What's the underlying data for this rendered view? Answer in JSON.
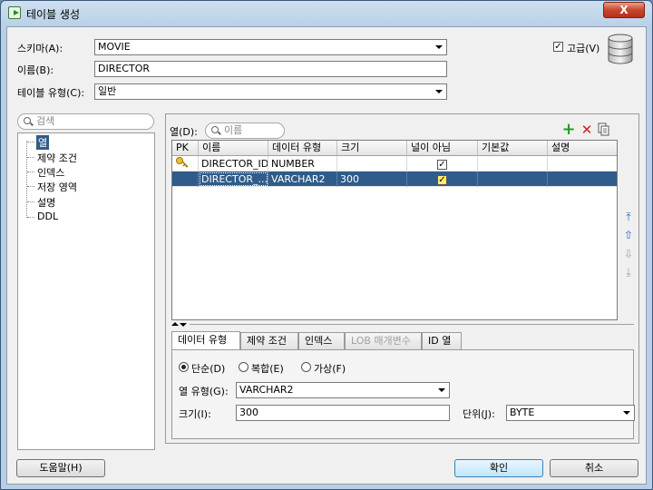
{
  "window": {
    "title": "테이블 생성",
    "close_label": "X"
  },
  "top": {
    "schema_label": "스키마(A):",
    "schema_value": "MOVIE",
    "name_label": "이름(B):",
    "name_value": "DIRECTOR",
    "type_label": "테이블 유형(C):",
    "type_value": "일반",
    "advanced_label": "고급(V)",
    "advanced_checked": true
  },
  "nav": {
    "search_placeholder": "검색",
    "items": [
      "열",
      "제약 조건",
      "인덱스",
      "저장 영역",
      "설명",
      "DDL"
    ],
    "selected": "열"
  },
  "columns_panel": {
    "filter_label": "열(D):",
    "filter_placeholder": "이름",
    "headers": [
      "PK",
      "이름",
      "데이터 유형",
      "크기",
      "널이 아님",
      "기본값",
      "설명"
    ],
    "rows": [
      {
        "pk": true,
        "name": "DIRECTOR_ID",
        "type": "NUMBER",
        "size": "",
        "not_null": true,
        "default": "",
        "comment": ""
      },
      {
        "pk": false,
        "name": "DIRECTOR_...",
        "type": "VARCHAR2",
        "size": "300",
        "not_null": true,
        "default": "",
        "comment": ""
      }
    ],
    "selected_row": 1
  },
  "tabs": {
    "items": [
      "데이터 유형",
      "제약 조건",
      "인덱스",
      "LOB 매개변수",
      "ID 열"
    ],
    "active": 0,
    "disabled": [
      3
    ]
  },
  "datatype": {
    "radio_simple": "단순(D)",
    "radio_complex": "복합(E)",
    "radio_virtual": "가상(F)",
    "selected_radio": "simple",
    "col_type_label": "열 유형(G):",
    "col_type_value": "VARCHAR2",
    "size_label": "크기(I):",
    "size_value": "300",
    "unit_label": "단위(J):",
    "unit_value": "BYTE"
  },
  "buttons": {
    "help": "도움말(H)",
    "ok": "확인",
    "cancel": "취소"
  }
}
